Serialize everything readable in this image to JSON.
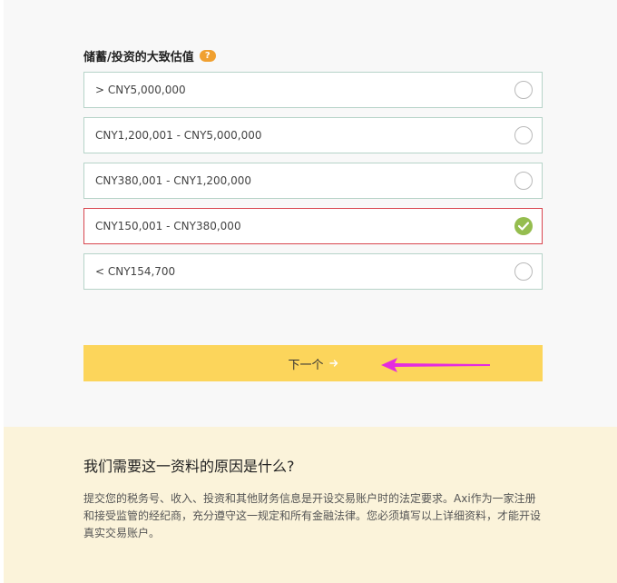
{
  "question": {
    "label": "储蓄/投资的大致估值",
    "help_symbol": "?"
  },
  "options": [
    {
      "label": "> CNY5,000,000",
      "selected": false
    },
    {
      "label": "CNY1,200,001 - CNY5,000,000",
      "selected": false
    },
    {
      "label": "CNY380,001 - CNY1,200,000",
      "selected": false
    },
    {
      "label": "CNY150,001 - CNY380,000",
      "selected": true
    },
    {
      "label": "< CNY154,700",
      "selected": false
    }
  ],
  "next_button": {
    "label": "下一个"
  },
  "info": {
    "title": "我们需要这一资料的原因是什么?",
    "body": "提交您的税务号、收入、投资和其他财务信息是开设交易账户时的法定要求。Axi作为一家注册和接受监管的经纪商，充分遵守这一规定和所有金融法律。您必须填写以上详细资料，才能开设真实交易账户。"
  },
  "colors": {
    "accent_yellow": "#fcd55b",
    "selected_border": "#d8454e",
    "check_green": "#95bd4f",
    "info_background": "#fbf3da",
    "annotation_arrow": "#e52be0"
  },
  "icons": {
    "help": "question-icon",
    "check": "check-icon",
    "next": "arrow-right-icon"
  }
}
